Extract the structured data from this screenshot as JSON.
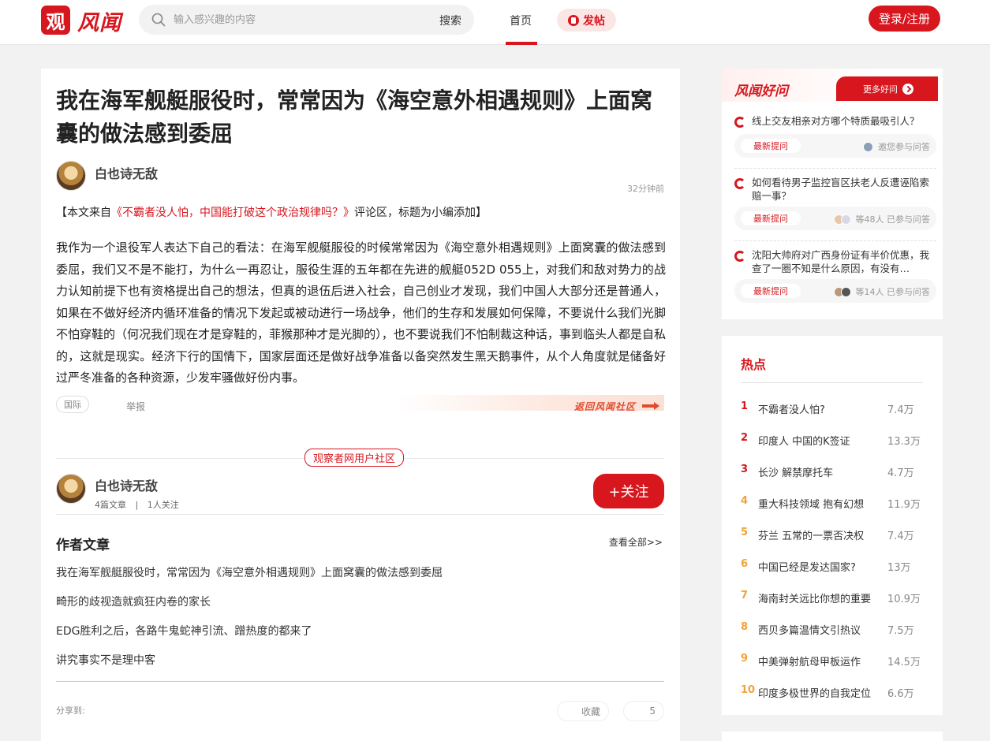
{
  "header": {
    "logo_badge": "观",
    "logo_text": "风闻",
    "search_placeholder": "输入感兴趣的内容",
    "search_button": "搜索",
    "nav_home": "首页",
    "post_button": "发帖",
    "login_button": "登录/注册",
    "accent_color": "#d7161e"
  },
  "article": {
    "title": "我在海军舰艇服役时，常常因为《海空意外相遇规则》上面窝囊的做法感到委屈",
    "author": "白也诗无敌",
    "time": "32分钟前",
    "source_prefix": "【本文来自",
    "source_link": "《不霸者没人怕，中国能打破这个政治规律吗？》",
    "source_suffix": "评论区，标题为小编添加】",
    "body": "我作为一个退役军人表达下自己的看法：在海军舰艇服役的时候常常因为《海空意外相遇规则》上面窝囊的做法感到委屈，我们又不是不能打，为什么一再忍让，服役生涯的五年都在先进的舰艇052D 055上，对我们和敌对势力的战力认知前提下也有资格提出自己的想法，但真的退伍后进入社会，自己创业才发现，我们中国人大部分还是普通人，如果在不做好经济内循环准备的情况下发起或被动进行一场战争，他们的生存和发展如何保障，不要说什么我们光脚不怕穿鞋的（何况我们现在才是穿鞋的，菲猴那种才是光脚的），也不要说我们不怕制裁这种话，事到临头人都是自私的，这就是现实。经济下行的国情下，国家层面还是做好战争准备以备突然发生黑天鹅事件，从个人角度就是储备好过严冬准备的各种资源，少发牢骚做好份内事。",
    "tag": "国际",
    "report": "举报",
    "return_banner": "返回风闻社区"
  },
  "author_box": {
    "community_label": "观察者网用户社区",
    "name": "白也诗无敌",
    "articles": "4篇文章",
    "separator": "|",
    "followers": "1人关注",
    "follow_button": "+关注",
    "section_title": "作者文章",
    "view_all": "查看全部>>",
    "articles_list": [
      "我在海军舰艇服役时，常常因为《海空意外相遇规则》上面窝囊的做法感到委屈",
      "畸形的歧视造就疯狂内卷的家长",
      "EDG胜利之后，各路牛鬼蛇神引流、蹭热度的都来了",
      "讲究事实不是理中客"
    ],
    "share_label": "分享到:",
    "collect": "收藏",
    "likes": "5"
  },
  "qa": {
    "logo": "风闻好问",
    "more": "更多好问",
    "items": [
      {
        "question": "线上交友相亲对方哪个特质最吸引人？",
        "badge": "最新提问",
        "participants": "邀您参与问答"
      },
      {
        "question": "如何看待男子监控盲区扶老人反遭诬陷索赔一事？",
        "badge": "最新提问",
        "participants": "等48人 已参与问答"
      },
      {
        "question": "沈阳大帅府对广西身份证有半价优惠，我查了一圈不知是什么原因，有没有…",
        "badge": "最新提问",
        "participants": "等14人 已参与问答"
      }
    ]
  },
  "hot": {
    "title": "热点",
    "items": [
      {
        "rank": "1",
        "text": "不霸者没人怕?",
        "count": "7.4万"
      },
      {
        "rank": "2",
        "text": "印度人 中国的K签证",
        "count": "13.3万"
      },
      {
        "rank": "3",
        "text": "长沙 解禁摩托车",
        "count": "4.7万"
      },
      {
        "rank": "4",
        "text": "重大科技领域 抱有幻想",
        "count": "11.9万"
      },
      {
        "rank": "5",
        "text": "芬兰 五常的一票否决权",
        "count": "7.4万"
      },
      {
        "rank": "6",
        "text": "中国已经是发达国家?",
        "count": "13万"
      },
      {
        "rank": "7",
        "text": "海南封关远比你想的重要",
        "count": "10.9万"
      },
      {
        "rank": "8",
        "text": "西贝多篇温情文引热议",
        "count": "7.5万"
      },
      {
        "rank": "9",
        "text": "中美弹射航母甲板运作",
        "count": "14.5万"
      },
      {
        "rank": "10",
        "text": "印度多极世界的自我定位",
        "count": "6.6万"
      }
    ],
    "rank_colors": {
      "top": "#d7161e",
      "rest": "#f0a23c"
    }
  }
}
